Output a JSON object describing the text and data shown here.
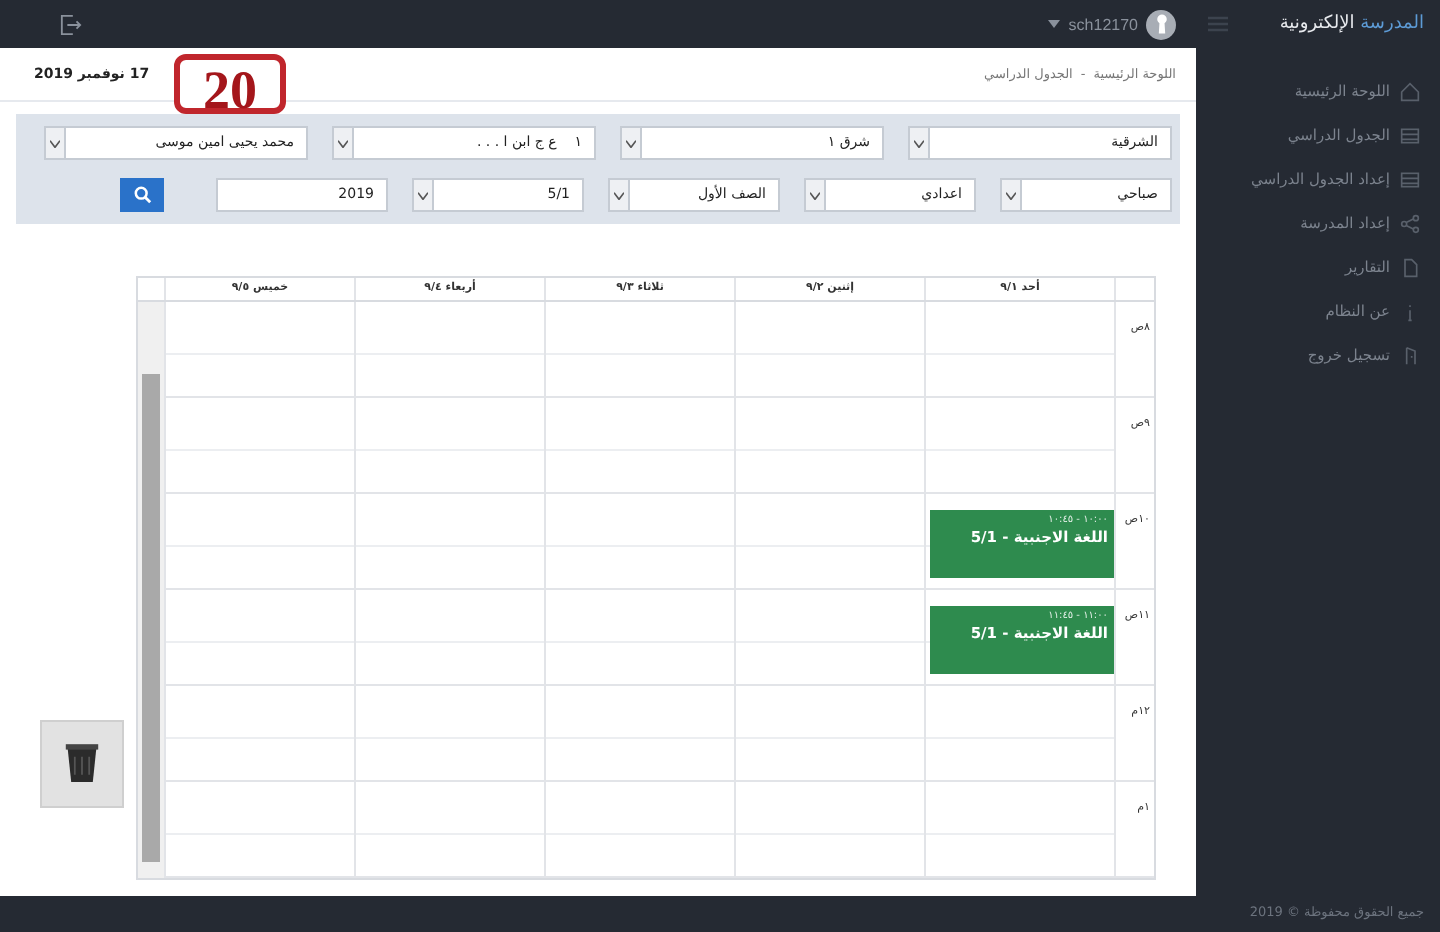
{
  "brand": {
    "accent": "المدرسة",
    "rest": "الإلكترونية"
  },
  "user": "sch12170",
  "step_badge": "20",
  "date": "17 نوفمبر 2019",
  "breadcrumb": [
    "اللوحة الرئيسية",
    "الجدول الدراسي"
  ],
  "breadcrumb_separator": "-",
  "sidebar": {
    "items": [
      {
        "label": "اللوحة الرئيسية",
        "kind": "home"
      },
      {
        "label": "الجدول الدراسي",
        "kind": "table"
      },
      {
        "label": "إعداد الجدول الدراسي",
        "kind": "table"
      },
      {
        "label": "إعداد المدرسة",
        "kind": "share"
      },
      {
        "label": "التقارير",
        "kind": "file"
      },
      {
        "label": "عن النظام",
        "kind": "info"
      },
      {
        "label": "تسجيل خروج",
        "kind": "logout"
      }
    ],
    "footer": "جميع الحقوق محفوظة © 2019"
  },
  "filters": [
    [
      {
        "kind": "select",
        "value": "الشرقية"
      },
      {
        "kind": "select",
        "value": "شرق ١"
      },
      {
        "kind": "select",
        "value": "١    ع ج ابن ا . . ."
      },
      {
        "kind": "select",
        "value": "محمد يحيى امين موسى"
      }
    ],
    [
      {
        "kind": "select",
        "value": "صباحي"
      },
      {
        "kind": "select",
        "value": "اعدادي"
      },
      {
        "kind": "select",
        "value": "الصف الأول"
      },
      {
        "kind": "select",
        "value": "5/1"
      },
      {
        "kind": "input",
        "value": "2019"
      },
      {
        "kind": "search"
      }
    ]
  ],
  "timetable": {
    "days": [
      "أحد ٩/١",
      "إثنين ٩/٢",
      "ثلاثاء ٩/٣",
      "أربعاء ٩/٤",
      "خميس ٩/٥"
    ],
    "hours": [
      {
        "time": "٨ص",
        "cells": [
          {
            "kind": "empty"
          },
          {
            "kind": "empty"
          },
          {
            "kind": "empty"
          },
          {
            "kind": "empty"
          },
          {
            "kind": "empty"
          }
        ]
      },
      {
        "time": "٩ص",
        "cells": [
          {
            "kind": "empty"
          },
          {
            "kind": "empty"
          },
          {
            "kind": "empty"
          },
          {
            "kind": "empty"
          },
          {
            "kind": "empty"
          }
        ]
      },
      {
        "time": "١٠ص",
        "cells": [
          {
            "kind": "event",
            "period": "١٠:٠٠ - ١٠:٤٥",
            "title": "اللغة الاجنبية - 5/1"
          },
          {
            "kind": "empty"
          },
          {
            "kind": "empty"
          },
          {
            "kind": "empty"
          },
          {
            "kind": "empty"
          }
        ]
      },
      {
        "time": "١١ص",
        "cells": [
          {
            "kind": "event",
            "period": "١١:٠٠ - ١١:٤٥",
            "title": "اللغة الاجنبية - 5/1"
          },
          {
            "kind": "empty"
          },
          {
            "kind": "empty"
          },
          {
            "kind": "empty"
          },
          {
            "kind": "empty"
          }
        ]
      },
      {
        "time": "١٢م",
        "cells": [
          {
            "kind": "empty"
          },
          {
            "kind": "empty"
          },
          {
            "kind": "empty"
          },
          {
            "kind": "empty"
          },
          {
            "kind": "empty"
          }
        ]
      },
      {
        "time": "١م",
        "cells": [
          {
            "kind": "empty"
          },
          {
            "kind": "empty"
          },
          {
            "kind": "empty"
          },
          {
            "kind": "empty"
          },
          {
            "kind": "empty"
          }
        ]
      }
    ]
  }
}
